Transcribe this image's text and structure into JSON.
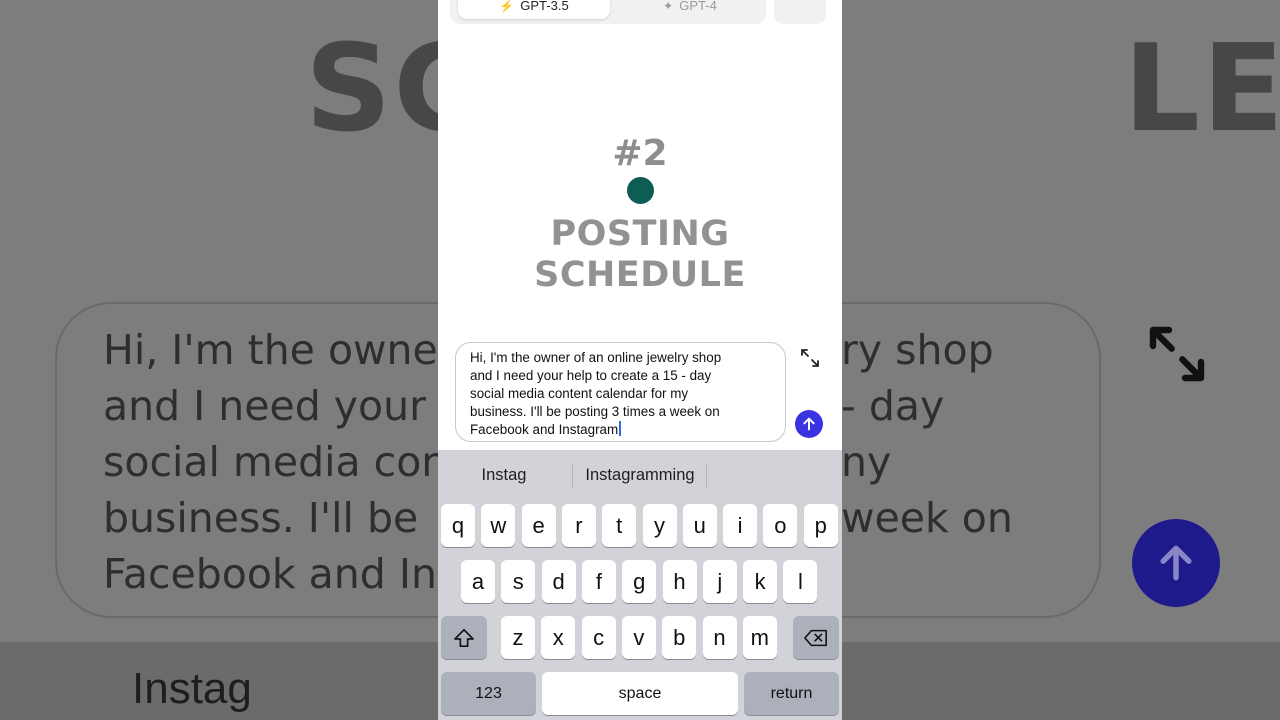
{
  "background": {
    "title_left": "SC",
    "title_right": "LE",
    "prompt_lines": [
      "Hi, I'm the owne",
      "and I need your",
      "social media con",
      "business. I'll be",
      "Facebook and In"
    ],
    "prompt_lines_right": [
      "ry shop",
      "- day",
      "ny",
      "week on",
      ""
    ],
    "keyboard_suggestion": "Instag"
  },
  "header": {
    "model_tab_active": "GPT-3.5",
    "model_tab_inactive": "GPT-4"
  },
  "main": {
    "number": "#2",
    "title_line1": "POSTING",
    "title_line2": "SCHEDULE",
    "accent_color": "#0d5d55"
  },
  "composer": {
    "text": "Hi, I'm the owner of an online jewelry shop\nand I need your help to create a 15 - day\nsocial media content calendar for my\nbusiness. I'll be posting 3 times a week on\nFacebook and Instagram",
    "send_color": "#3a34e0"
  },
  "keyboard": {
    "suggestions": [
      "Instag",
      "Instagramming"
    ],
    "row1": [
      "q",
      "w",
      "e",
      "r",
      "t",
      "y",
      "u",
      "i",
      "o",
      "p"
    ],
    "row2": [
      "a",
      "s",
      "d",
      "f",
      "g",
      "h",
      "j",
      "k",
      "l"
    ],
    "row3": [
      "z",
      "x",
      "c",
      "v",
      "b",
      "n",
      "m"
    ],
    "numbers_label": "123",
    "space_label": "space",
    "return_label": "return"
  }
}
